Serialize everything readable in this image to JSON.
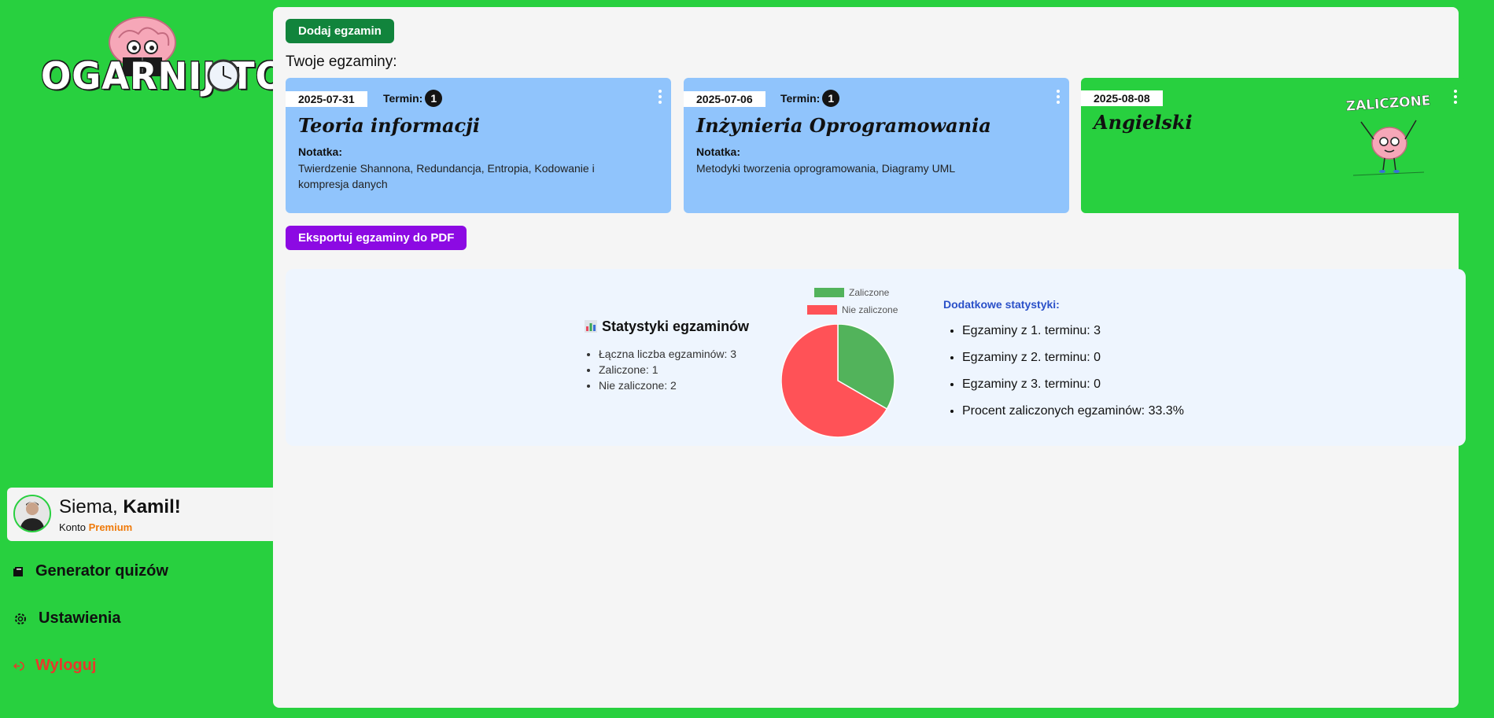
{
  "brand": {
    "logo_text": "OGARNIJ.TO"
  },
  "user": {
    "greeting_prefix": "Siema, ",
    "name": "Kamil!",
    "account_prefix": "Konto ",
    "account_tier": "Premium"
  },
  "nav": [
    {
      "label": "Generator quizów",
      "icon": "book-icon"
    },
    {
      "label": "Ustawienia",
      "icon": "gear-icon"
    },
    {
      "label": "Wyloguj",
      "icon": "logout-icon"
    }
  ],
  "main": {
    "add_button": "Dodaj egzamin",
    "section_title": "Twoje egzaminy:",
    "export_button": "Eksportuj egzaminy do PDF"
  },
  "exams": [
    {
      "date": "2025-07-31",
      "termin_label": "Termin:",
      "termin": "1",
      "title": "Teoria informacji",
      "note_label": "Notatka:",
      "note": "Twierdzenie Shannona, Redundancja, Entropia, Kodowanie i kompresja danych",
      "status": "pending",
      "color": "#90c4fc"
    },
    {
      "date": "2025-07-06",
      "termin_label": "Termin:",
      "termin": "1",
      "title": "Inżynieria Oprogramowania",
      "note_label": "Notatka:",
      "note": "Metodyki tworzenia oprogramowania, Diagramy UML",
      "status": "pending",
      "color": "#90c4fc"
    },
    {
      "date": "2025-08-08",
      "title": "Angielski",
      "status": "passed",
      "stamp": "ZALICZONE",
      "color": "#28d03f"
    }
  ],
  "stats": {
    "title": "Statystyki egzaminów",
    "icon": "bar-chart-icon",
    "items": [
      "Łączna liczba egzaminów: 3",
      "Zaliczone: 1",
      "Nie zaliczone: 2"
    ],
    "extra_title": "Dodatkowe statystyki:",
    "extra": [
      {
        "label": "Egzaminy z 1. terminu: ",
        "value": "3"
      },
      {
        "label": "Egzaminy z 2. terminu: ",
        "value": "0"
      },
      {
        "label": "Egzaminy z 3. terminu: ",
        "value": "0"
      },
      {
        "label": "Procent zaliczonych egzaminów: ",
        "value": "33.3%"
      }
    ]
  },
  "chart_data": {
    "type": "pie",
    "categories": [
      "Zaliczone",
      "Nie zaliczone"
    ],
    "values": [
      1,
      2
    ],
    "colors": [
      "#52b35b",
      "#ff5257"
    ],
    "legend": "top"
  },
  "colors": {
    "sidebar": "#28d03f",
    "card_pending": "#90c4fc",
    "add_button": "#11843c",
    "export_button": "#8c0ae3",
    "logout": "#e8382b",
    "premium": "#ef7a0a"
  }
}
